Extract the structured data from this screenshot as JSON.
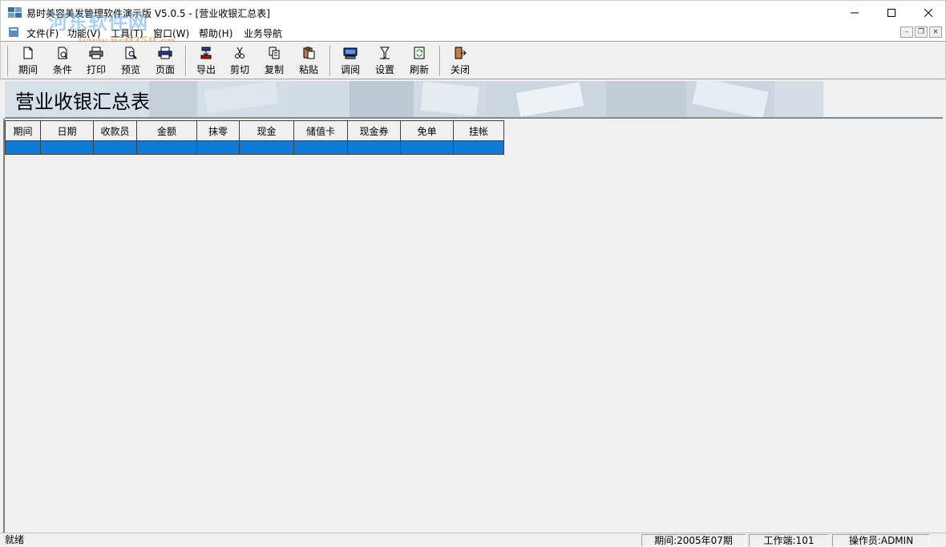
{
  "window": {
    "title": "易时美容美发管理软件演示版 V5.0.5 - [营业收银汇总表]"
  },
  "watermark": {
    "name": "河东软件网",
    "url": "www.pc0359.cn"
  },
  "menu": {
    "items": [
      {
        "label": "文件(F)"
      },
      {
        "label": "功能(V)"
      },
      {
        "label": "工具(T)"
      },
      {
        "label": "窗口(W)"
      },
      {
        "label": "帮助(H)"
      },
      {
        "label": "业务导航"
      }
    ]
  },
  "toolbar": {
    "buttons": [
      {
        "label": "期间",
        "icon": "document-icon"
      },
      {
        "label": "条件",
        "icon": "filter-doc-icon"
      },
      {
        "label": "打印",
        "icon": "printer-icon"
      },
      {
        "label": "预览",
        "icon": "preview-icon"
      },
      {
        "label": "页面",
        "icon": "page-setup-icon"
      },
      {
        "label": "导出",
        "icon": "export-icon"
      },
      {
        "label": "剪切",
        "icon": "scissors-icon"
      },
      {
        "label": "复制",
        "icon": "copy-icon"
      },
      {
        "label": "粘贴",
        "icon": "paste-icon"
      },
      {
        "label": "调阅",
        "icon": "lookup-icon"
      },
      {
        "label": "设置",
        "icon": "settings-icon"
      },
      {
        "label": "刷新",
        "icon": "refresh-icon"
      },
      {
        "label": "关闭",
        "icon": "exit-door-icon"
      }
    ]
  },
  "report": {
    "title": "营业收银汇总表"
  },
  "table": {
    "columns": [
      "期间",
      "日期",
      "收款员",
      "金额",
      "抹零",
      "现金",
      "储值卡",
      "现金券",
      "免单",
      "挂帐"
    ],
    "rows": [
      [
        "",
        "",
        "",
        "",
        "",
        "",
        "",
        "",
        "",
        ""
      ]
    ]
  },
  "colors": {
    "selection_row": "#0f7ad8",
    "banner": "#d2dce6"
  },
  "statusbar": {
    "ready": "就绪",
    "period": "期间:2005年07期",
    "terminal": "工作端:101",
    "operator": "操作员:ADMIN"
  }
}
